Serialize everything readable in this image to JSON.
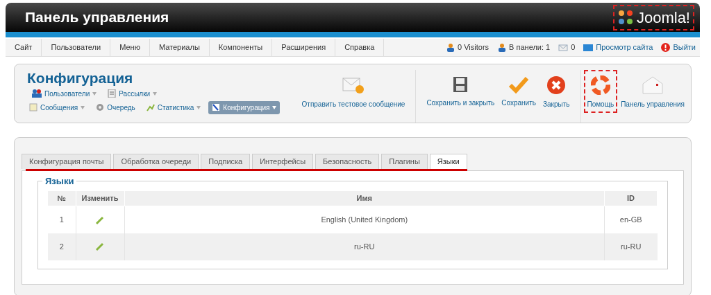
{
  "header": {
    "title": "Панель управления",
    "logo": "Joomla!"
  },
  "menu": [
    {
      "label": "Сайт"
    },
    {
      "label": "Пользователи"
    },
    {
      "label": "Меню"
    },
    {
      "label": "Материалы"
    },
    {
      "label": "Компоненты"
    },
    {
      "label": "Расширения"
    },
    {
      "label": "Справка"
    }
  ],
  "status": [
    {
      "kind": "visitors",
      "label": "0 Visitors"
    },
    {
      "kind": "admins",
      "label": "В панели: 1"
    },
    {
      "kind": "messages",
      "label": "0"
    },
    {
      "kind": "site",
      "label": "Просмотр сайта"
    },
    {
      "kind": "logout",
      "label": "Выйти"
    }
  ],
  "component": {
    "title": "Конфигурация",
    "submenu": [
      [
        {
          "kind": "users",
          "label": "Пользователи",
          "dropdown": true,
          "selected": false
        },
        {
          "kind": "lists",
          "label": "Рассылки",
          "dropdown": true,
          "selected": false
        }
      ],
      [
        {
          "kind": "messages",
          "label": "Сообщения",
          "dropdown": true,
          "selected": false
        },
        {
          "kind": "queue",
          "label": "Очередь",
          "dropdown": false,
          "selected": false
        },
        {
          "kind": "stats",
          "label": "Статистика",
          "dropdown": true,
          "selected": false
        },
        {
          "kind": "config",
          "label": "Конфигурация",
          "dropdown": true,
          "selected": true
        }
      ]
    ]
  },
  "toolbar": [
    {
      "kind": "mail",
      "label": "Отправить тестовое сообщение",
      "highlighted": false
    },
    {
      "kind": "save-close",
      "label": "Сохранить и закрыть",
      "highlighted": false
    },
    {
      "kind": "save",
      "label": "Сохранить",
      "highlighted": false
    },
    {
      "kind": "close",
      "label": "Закрыть",
      "highlighted": false
    },
    {
      "kind": "help",
      "label": "Помощь",
      "highlighted": true
    },
    {
      "kind": "dashboard",
      "label": "Панель управления",
      "highlighted": false
    }
  ],
  "tabs": [
    {
      "label": "Конфигурация почты",
      "selected": false
    },
    {
      "label": "Обработка очереди",
      "selected": false
    },
    {
      "label": "Подписка",
      "selected": false
    },
    {
      "label": "Интерфейсы",
      "selected": false
    },
    {
      "label": "Безопасность",
      "selected": false
    },
    {
      "label": "Плагины",
      "selected": false
    },
    {
      "label": "Языки",
      "selected": true
    }
  ],
  "fieldset": {
    "legend": "Языки",
    "table": {
      "columns": [
        "№",
        "Изменить",
        "Имя",
        "ID"
      ],
      "rows": [
        [
          "1",
          "",
          "English (United Kingdom)",
          "en-GB"
        ],
        [
          "2",
          "",
          "ru-RU",
          "ru-RU"
        ]
      ]
    }
  }
}
